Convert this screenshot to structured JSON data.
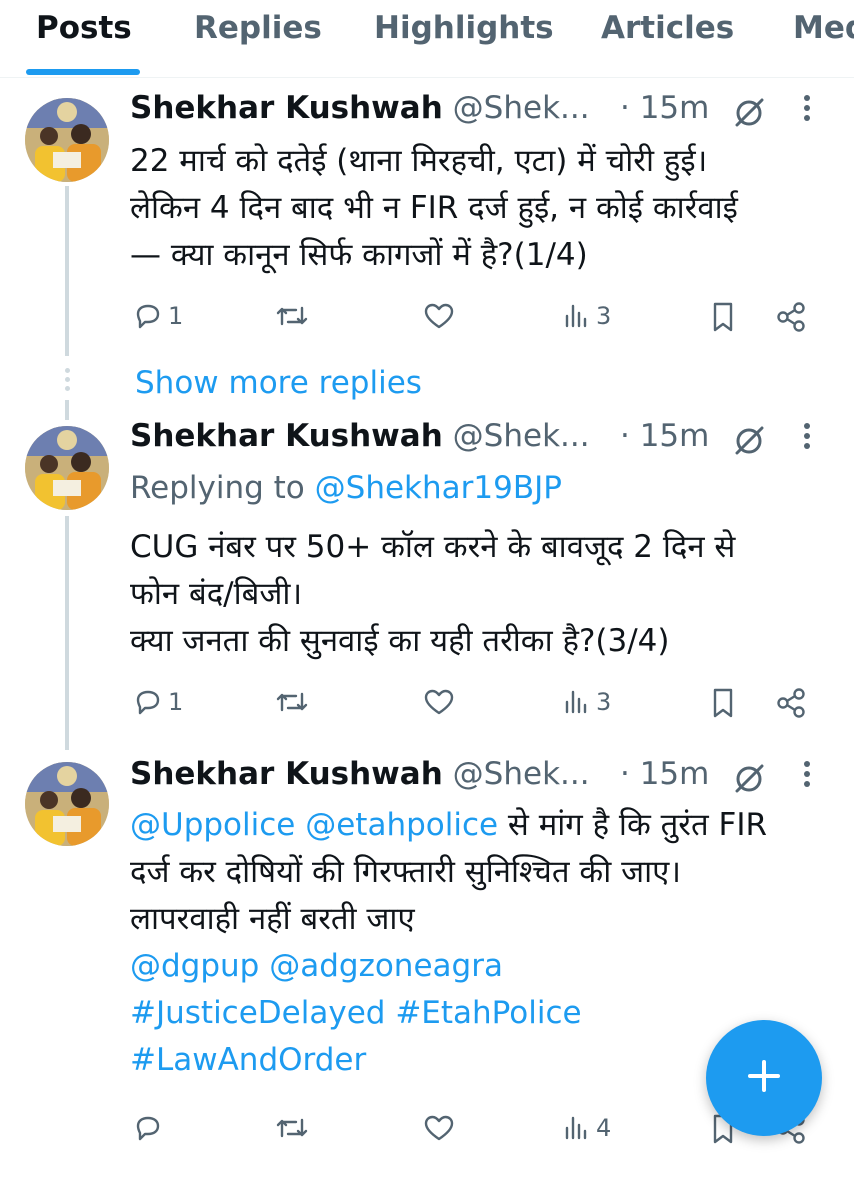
{
  "tabs": [
    {
      "label": "Posts",
      "active": true
    },
    {
      "label": "Replies",
      "active": false
    },
    {
      "label": "Highlights",
      "active": false
    },
    {
      "label": "Articles",
      "active": false
    },
    {
      "label": "Media",
      "active": false
    }
  ],
  "tweets": [
    {
      "author": "Shekhar Kushwah",
      "handle": "@Shek...",
      "time": "· 15m",
      "replying_to_prefix": "",
      "replying_to_handle": "",
      "lines": [
        "22 मार्च को दतेई (थाना मिरहची, एटा) में चोरी हुई।",
        "लेकिन 4 दिन बाद भी न FIR दर्ज हुई, न कोई कार्रवाई",
        "— क्या कानून सिर्फ कागजों में है?(1/4)"
      ],
      "reply_count": "1",
      "repost_count": "",
      "like_count": "",
      "view_count": "3"
    },
    {
      "author": "Shekhar Kushwah",
      "handle": "@Shek...",
      "time": "· 15m",
      "replying_to_prefix": "Replying to",
      "replying_to_handle": "@Shekhar19BJP",
      "lines": [
        "CUG नंबर पर 50+ कॉल करने के बावजूद 2 दिन से",
        "फोन बंद/बिजी।",
        "क्या जनता की सुनवाई का यही तरीका है?(3/4)"
      ],
      "reply_count": "1",
      "repost_count": "",
      "like_count": "",
      "view_count": "3"
    },
    {
      "author": "Shekhar Kushwah",
      "handle": "@Shek...",
      "time": "· 15m",
      "mentions_line1": [
        "@Uppolice",
        "@etahpolice"
      ],
      "line1_rest": " से मांग है कि तुरंत FIR",
      "lines": [
        "दर्ज कर दोषियों की गिरफ्तारी सुनिश्चित की जाए।",
        "लापरवाही नहीं बरती जाए"
      ],
      "mentions_line2": [
        "@dgpup",
        "@adgzoneagra"
      ],
      "hashtags_line3": [
        "#JusticeDelayed",
        "#EtahPolice"
      ],
      "hashtags_line4": [
        "#LawAndOrder"
      ],
      "reply_count": "",
      "repost_count": "",
      "like_count": "",
      "view_count": "4"
    }
  ],
  "show_more_replies": "Show more replies",
  "icons": {
    "reply": "reply-icon",
    "repost": "repost-icon",
    "like": "heart-icon",
    "views": "views-icon",
    "bookmark": "bookmark-icon",
    "share": "share-icon",
    "grok": "grok-icon",
    "more": "more-icon",
    "compose": "plus-icon"
  },
  "colors": {
    "accent": "#1d9bf0",
    "text": "#0f1419",
    "muted": "#536471",
    "thread_line": "#cfd9de"
  }
}
